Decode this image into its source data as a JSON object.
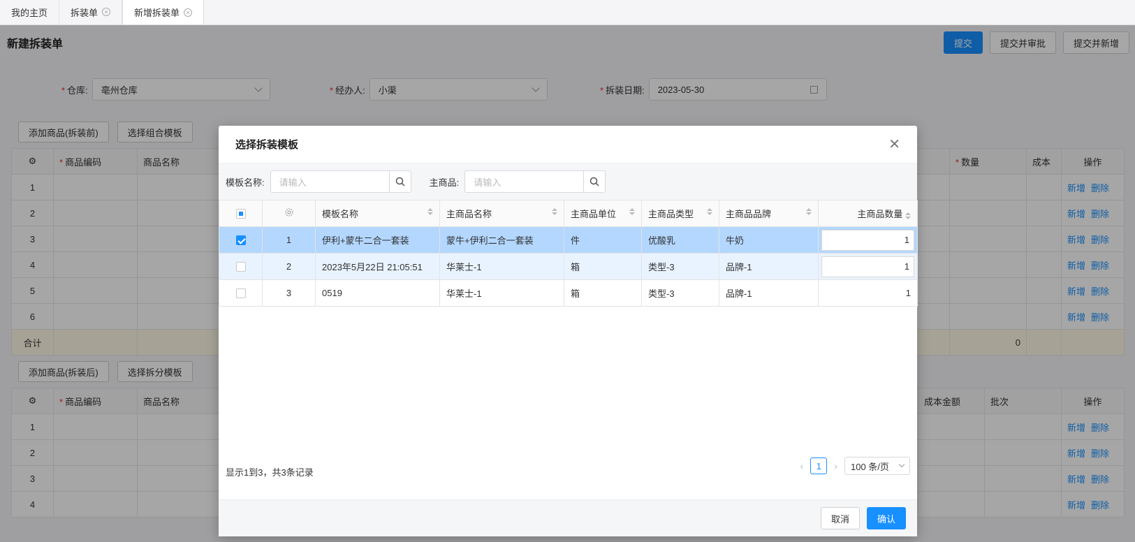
{
  "tabs": [
    {
      "label": "我的主页",
      "closable": false
    },
    {
      "label": "拆装单",
      "closable": true
    },
    {
      "label": "新增拆装单",
      "closable": true,
      "active": true
    }
  ],
  "page": {
    "title": "新建拆装单",
    "buttons": {
      "submit": "提交",
      "submit_approve": "提交并审批",
      "submit_new": "提交并新增"
    },
    "form": {
      "warehouse_label": "仓库:",
      "warehouse_value": "亳州仓库",
      "handler_label": "经办人:",
      "handler_value": "小渠",
      "date_label": "拆装日期:",
      "date_value": "2023-05-30"
    },
    "top_section": {
      "add_btn": "添加商品(拆装前)",
      "template_btn": "选择组合模板",
      "col_code": "商品编码",
      "col_name": "商品名称",
      "col_qty": "数量",
      "col_cost": "成本",
      "col_ops": "操作",
      "rows": [
        "1",
        "2",
        "3",
        "4",
        "5",
        "6"
      ],
      "sum_label": "合计",
      "sum_qty": "0",
      "op_add": "新增",
      "op_del": "删除"
    },
    "bottom_section": {
      "add_btn": "添加商品(拆装后)",
      "template_btn": "选择拆分模板",
      "col_code": "商品编码",
      "col_name": "商品名称",
      "col_cost_amount": "成本金额",
      "col_batch": "批次",
      "col_ops": "操作",
      "rows": [
        "1",
        "2",
        "3",
        "4"
      ],
      "op_add": "新增",
      "op_del": "删除"
    }
  },
  "modal": {
    "title": "选择拆装模板",
    "search": {
      "template_label": "模板名称:",
      "template_placeholder": "请输入",
      "main_label": "主商品:",
      "main_placeholder": "请输入"
    },
    "columns": [
      "模板名称",
      "主商品名称",
      "主商品单位",
      "主商品类型",
      "主商品品牌",
      "主商品数量"
    ],
    "rows": [
      {
        "no": "1",
        "template": "伊利+蒙牛二合一套装",
        "main_name": "蒙牛+伊利二合一套装",
        "unit": "件",
        "type": "优酸乳",
        "brand": "牛奶",
        "qty": "1",
        "checked": true
      },
      {
        "no": "2",
        "template": "2023年5月22日 21:05:51",
        "main_name": "华莱士-1",
        "unit": "箱",
        "type": "类型-3",
        "brand": "品牌-1",
        "qty": "1",
        "checked": false
      },
      {
        "no": "3",
        "template": "0519",
        "main_name": "华莱士-1",
        "unit": "箱",
        "type": "类型-3",
        "brand": "品牌-1",
        "qty": "1",
        "checked": false
      }
    ],
    "footer_info": "显示1到3，共3条记录",
    "current_page": "1",
    "page_size": "100 条/页",
    "cancel": "取消",
    "confirm": "确认"
  }
}
